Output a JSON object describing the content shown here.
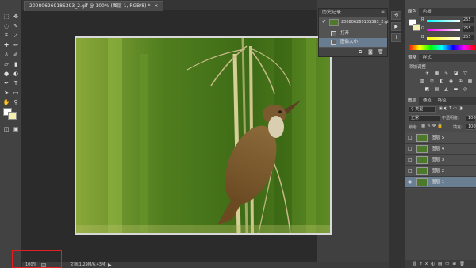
{
  "document": {
    "tab_title": "20080626918S393_2.gif @ 100% (图层 1, RGB/8) *",
    "zoom": "100%",
    "doc_info": "文档:1.29M/6.43M"
  },
  "toolbar": {
    "tools": [
      "marquee-icon",
      "lasso-icon",
      "crop-icon",
      "eyedropper-icon",
      "heal-icon",
      "brush-icon",
      "stamp-icon",
      "history-brush-icon",
      "eraser-icon",
      "gradient-icon",
      "blur-icon",
      "dodge-icon",
      "pen-icon",
      "type-icon",
      "path-select-icon",
      "shape-icon",
      "hand-icon",
      "zoom-icon"
    ]
  },
  "history_panel": {
    "title": "历史记录",
    "snapshot_label": "20080626918S393_2.gif",
    "items": [
      {
        "label": "打开"
      },
      {
        "label": "图像大小"
      }
    ]
  },
  "color_panel": {
    "tabs": [
      "颜色",
      "色板"
    ],
    "sliders": [
      {
        "channel": "R",
        "value": "255"
      },
      {
        "channel": "G",
        "value": "255"
      },
      {
        "channel": "B",
        "value": "255"
      }
    ],
    "colors": {
      "r": "#ff4040",
      "g": "#40ff40",
      "b": "#4060ff"
    }
  },
  "adjustments_panel": {
    "tabs": [
      "调整",
      "样式"
    ],
    "add_label": "添加调整"
  },
  "layers_panel": {
    "tabs": [
      "图层",
      "通道",
      "路径"
    ],
    "filter": "类型",
    "blend_mode": "正常",
    "opacity_label": "不透明度:",
    "opacity": "100%",
    "lock_label": "锁定:",
    "fill_label": "填充:",
    "fill": "100%",
    "layers": [
      {
        "name": "图层 5",
        "selected": false
      },
      {
        "name": "图层 4",
        "selected": false
      },
      {
        "name": "图层 3",
        "selected": false
      },
      {
        "name": "图层 2",
        "selected": false
      },
      {
        "name": "图层 1",
        "selected": true
      }
    ]
  }
}
